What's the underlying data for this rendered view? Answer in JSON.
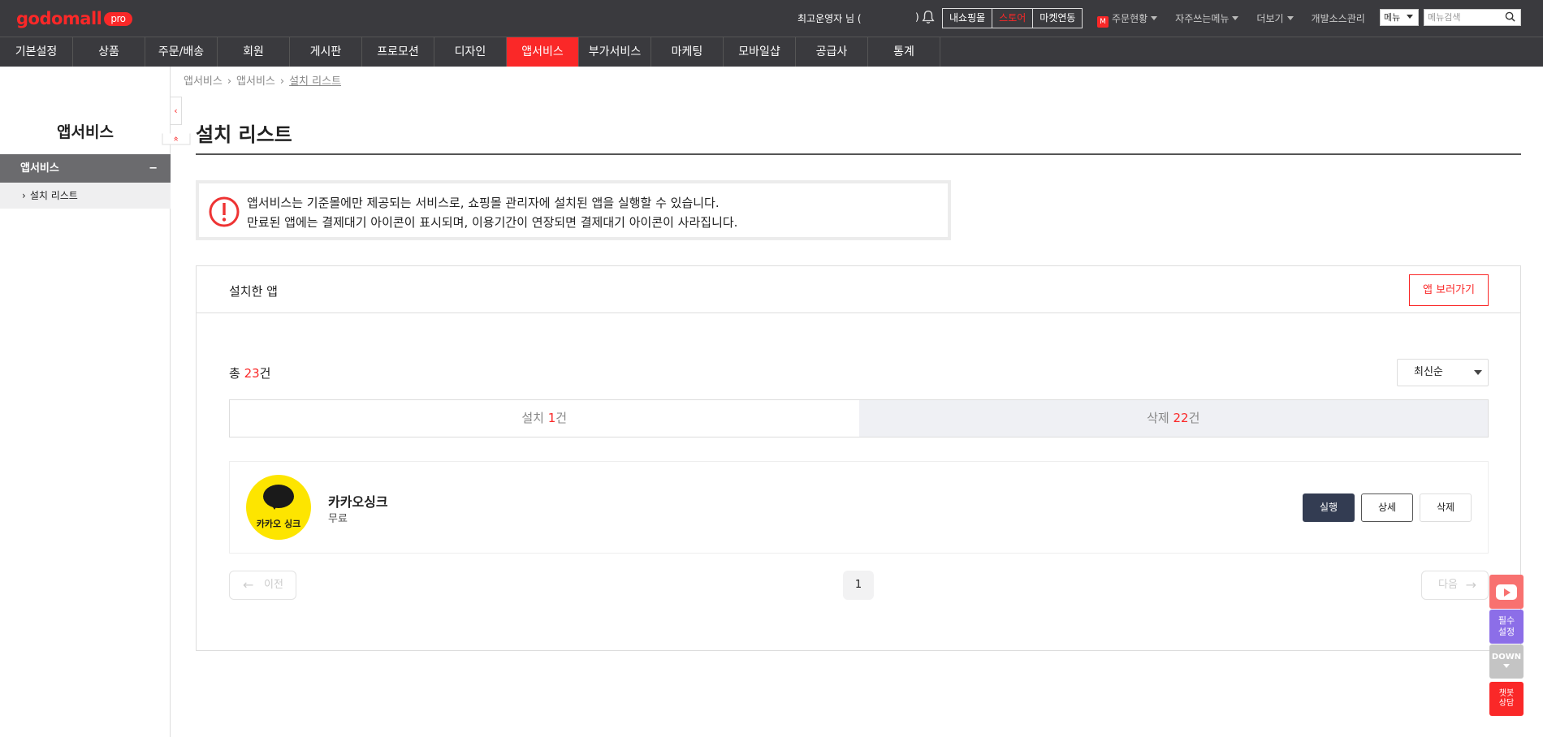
{
  "header": {
    "logo_text": "godomall",
    "logo_badge": "pro",
    "admin_name": "최고운영자 님 (",
    "admin_close": ")",
    "buttons": [
      "내쇼핑몰",
      "스토어",
      "마켓연동"
    ],
    "links": [
      {
        "label": "주문현황",
        "badge": "M"
      },
      {
        "label": "자주쓰는메뉴"
      },
      {
        "label": "더보기"
      },
      {
        "label": "개발소스관리"
      }
    ],
    "menu_select": "메뉴",
    "search_placeholder": "메뉴검색"
  },
  "nav": {
    "items": [
      "기본설정",
      "상품",
      "주문/배송",
      "회원",
      "게시판",
      "프로모션",
      "디자인",
      "앱서비스",
      "부가서비스",
      "마케팅",
      "모바일샵",
      "공급사",
      "통계"
    ],
    "active": "앱서비스"
  },
  "sidebar": {
    "title": "앱서비스",
    "section": "앱서비스",
    "section_toggle": "−",
    "items": [
      "설치 리스트"
    ],
    "fold_icons": [
      "‹",
      "«"
    ]
  },
  "breadcrumb": [
    "앱서비스",
    "앱서비스",
    "설치 리스트"
  ],
  "page": {
    "title": "설치 리스트",
    "notice_line1": "앱서비스는 기준몰에만 제공되는 서비스로, 쇼핑몰 관리자에 설치된 앱을 실행할 수 있습니다.",
    "notice_line2": "만료된 앱에는 결제대기 아이콘이 표시되며, 이용기간이 연장되면 결제대기 아이콘이 사라집니다."
  },
  "card": {
    "title": "설치한 앱",
    "more_button": "앱 보러가기",
    "total_prefix": "총 ",
    "total_count": "23",
    "total_suffix": "건",
    "sort": "최신순",
    "tabs": [
      {
        "prefix": "설치 ",
        "count": "1",
        "suffix": "건"
      },
      {
        "prefix": "삭제 ",
        "count": "22",
        "suffix": "건"
      }
    ],
    "apps": [
      {
        "name": "카카오싱크",
        "price": "무료",
        "icon_text": "카카오 싱크",
        "run": "실행",
        "detail": "상세",
        "delete": "삭제"
      }
    ],
    "pagination": {
      "prev": "이전",
      "page": "1",
      "next": "다음"
    }
  },
  "floating": {
    "required": [
      "필수",
      "설정"
    ],
    "down": "DOWN",
    "chat": [
      "챗봇",
      "상담"
    ]
  }
}
